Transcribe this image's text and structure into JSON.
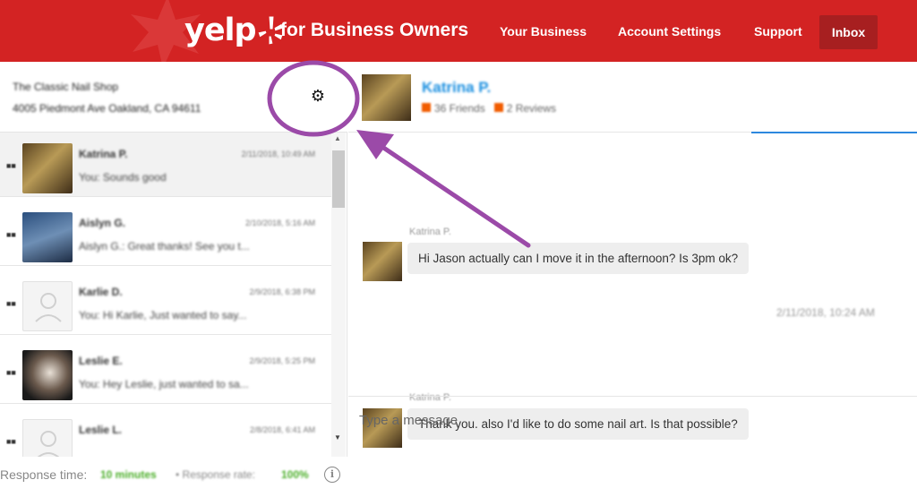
{
  "header": {
    "logo_text": "yelp",
    "tagline": "for Business Owners",
    "nav": {
      "your_business": "Your Business",
      "account_settings": "Account Settings",
      "support": "Support",
      "inbox": "Inbox"
    }
  },
  "business": {
    "name": "The Classic Nail Shop",
    "address": "4005 Piedmont Ave Oakland, CA 94611",
    "settings_icon": "gear-icon"
  },
  "conversations": [
    {
      "name": "Katrina P.",
      "date": "2/11/2018, 10:49 AM",
      "preview": "You: Sounds good",
      "selected": true
    },
    {
      "name": "Aislyn G.",
      "date": "2/10/2018, 5:16 AM",
      "preview": "Aislyn G.: Great thanks! See you t...",
      "selected": false
    },
    {
      "name": "Karlie D.",
      "date": "2/9/2018, 6:38 PM",
      "preview": "You: Hi Karlie, Just wanted to say...",
      "selected": false
    },
    {
      "name": "Leslie E.",
      "date": "2/9/2018, 5:25 PM",
      "preview": "You: Hey Leslie, just wanted to sa...",
      "selected": false
    },
    {
      "name": "Leslie L.",
      "date": "2/8/2018, 6:41 AM",
      "preview": "",
      "selected": false
    }
  ],
  "footer": {
    "response_time_label": "Response time:",
    "response_time_value": "10 minutes",
    "response_rate_label": "• Response rate:",
    "response_rate_value": "100%",
    "info_icon": "info-icon"
  },
  "chat": {
    "contact_name": "Katrina P.",
    "friends": "36 Friends",
    "reviews": "2 Reviews",
    "messages": [
      {
        "sender": "Katrina P.",
        "text": "Hi Jason actually can I move it in the afternoon? Is 3pm ok?"
      },
      {
        "sender": "Katrina P.",
        "text": "Thank you. also I'd like to do some nail art. Is that possible?"
      }
    ],
    "divider_date": "2/11/2018, 10:24 AM",
    "compose_placeholder": "Type a message"
  },
  "colors": {
    "brand_red": "#d32323",
    "inbox_active": "#a71f20",
    "link_blue": "#1a8fe0",
    "annotation_purple": "#9b4aa8",
    "positive_green": "#4caf2a"
  }
}
